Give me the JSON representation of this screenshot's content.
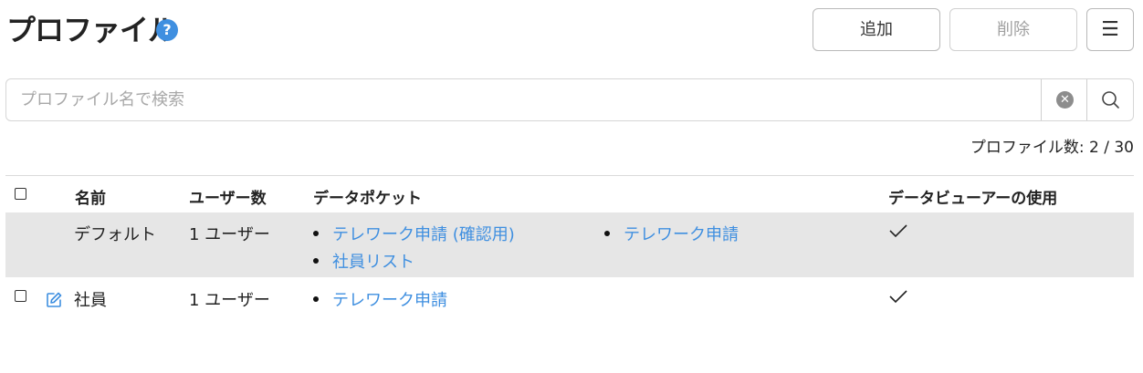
{
  "header": {
    "title": "プロファイル",
    "help_glyph": "?",
    "add_label": "追加",
    "delete_label": "削除",
    "menu_glyph": "☰"
  },
  "search": {
    "placeholder": "プロファイル名で検索",
    "value": "",
    "clear_glyph": "✕"
  },
  "count": {
    "label": "プロファイル数: 2 / 30"
  },
  "table": {
    "columns": [
      "名前",
      "ユーザー数",
      "データポケット",
      "データビューアーの使用"
    ],
    "rows": [
      {
        "name": "デフォルト",
        "users": "1 ユーザー",
        "data_pockets": [
          "テレワーク申請 (確認用)",
          "社員リスト",
          "テレワーク申請"
        ],
        "data_viewer": "✓",
        "selected": false,
        "highlighted": true
      },
      {
        "name": "社員",
        "users": "1 ユーザー",
        "data_pockets": [
          "テレワーク申請"
        ],
        "data_viewer": "✓",
        "selected": false,
        "highlighted": false
      }
    ]
  },
  "icons": {
    "help": "question-circle-icon",
    "menu": "hamburger-icon",
    "clear": "clear-circle-icon",
    "search": "search-icon",
    "edit": "edit-icon",
    "check": "checkmark-icon"
  },
  "colors": {
    "accent": "#3f8fe0",
    "row_highlight": "#e6e6e6",
    "border": "#d6d6d6"
  }
}
